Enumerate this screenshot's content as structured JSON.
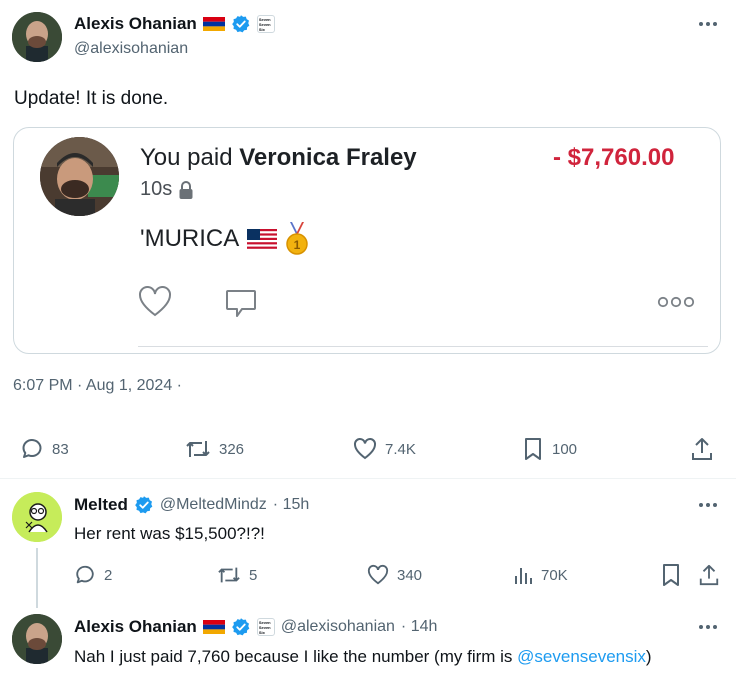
{
  "main_tweet": {
    "author_name": "Alexis Ohanian",
    "handle": "@alexisohanian",
    "badge_text": "Seven Seven Six",
    "text": "Update! It is done.",
    "timestamp": "6:07 PM · Aug 1, 2024 ·",
    "stats": {
      "replies": "83",
      "retweets": "326",
      "likes": "7.4K",
      "bookmarks": "100"
    }
  },
  "payment_card": {
    "prefix": "You paid",
    "recipient": "Veronica Fraley",
    "amount": "- $7,760.00",
    "time": "10s",
    "message": "'MURICA",
    "message_emojis": [
      "us-flag",
      "first-place-medal"
    ]
  },
  "replies": [
    {
      "author_name": "Melted",
      "handle": "@MeltedMindz",
      "time": "· 15h",
      "text": "Her rent was $15,500?!?!",
      "stats": {
        "replies": "2",
        "retweets": "5",
        "likes": "340",
        "views": "70K"
      }
    },
    {
      "author_name": "Alexis Ohanian",
      "handle": "@alexisohanian",
      "time": "· 14h",
      "text": "Nah I just paid 7,760 because I like the number (my firm is ",
      "link": "@sevensevensix",
      "text_end": ")"
    }
  ],
  "colors": {
    "verified": "#1d9bf0",
    "amount_red": "#d0243c",
    "secondary_text": "#536471",
    "link": "#1d9bf0"
  }
}
